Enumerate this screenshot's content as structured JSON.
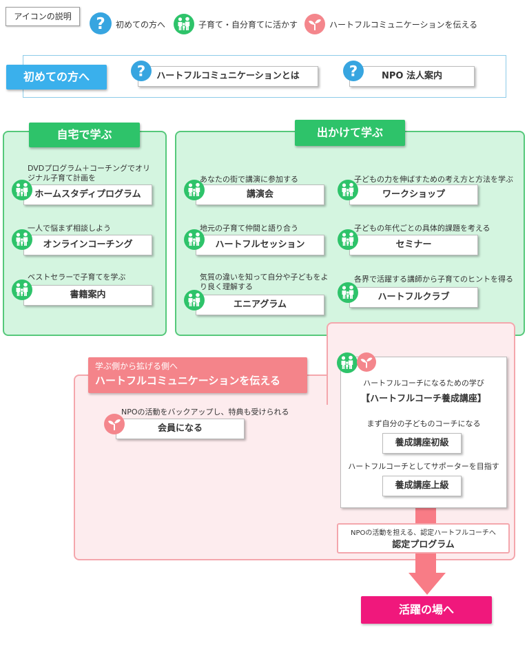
{
  "legend": {
    "label": "アイコンの説明",
    "items": [
      {
        "icon": "question-icon",
        "text": "初めての方へ"
      },
      {
        "icon": "family-icon",
        "text": "子育て・自分育てに活かす"
      },
      {
        "icon": "sprout-icon",
        "text": "ハートフルコミュニケーションを伝える"
      }
    ]
  },
  "intro": {
    "title": "初めての方へ",
    "buttons": [
      "ハートフルコミュニケーションとは",
      "NPO 法人案内"
    ]
  },
  "home": {
    "title": "自宅で学ぶ",
    "items": [
      {
        "desc": "DVDプログラム＋コーチングでオリジナル子育て計画を",
        "label": "ホームスタディプログラム"
      },
      {
        "desc": "一人で悩まず相談しよう",
        "label": "オンラインコーチング"
      },
      {
        "desc": "ベストセラーで子育てを学ぶ",
        "label": "書籍案内"
      }
    ]
  },
  "outside": {
    "title": "出かけて学ぶ",
    "items": [
      {
        "desc": "あなたの街で講演に参加する",
        "label": "講演会"
      },
      {
        "desc": "子どもの力を伸ばすための考え方と方法を学ぶ",
        "label": "ワークショップ"
      },
      {
        "desc": "地元の子育て仲間と語り合う",
        "label": "ハートフルセッション"
      },
      {
        "desc": "子どもの年代ごとの具体的課題を考える",
        "label": "セミナー"
      },
      {
        "desc": "気質の違いを知って自分や子どもをより良く理解する",
        "label": "エニアグラム"
      },
      {
        "desc": "各界で活躍する講師から子育てのヒントを得る",
        "label": "ハートフルクラブ"
      }
    ]
  },
  "share": {
    "subtitle": "学ぶ側から拡げる側へ",
    "title": "ハートフルコミュニケーションを伝える",
    "member_desc": "NPOの活動をバックアップし、特典も受けられる",
    "member_label": "会員になる"
  },
  "coach": {
    "intro": "ハートフルコーチになるための学び",
    "course_title": "【ハートフルコーチ養成講座】",
    "basic_desc": "まず自分の子どものコーチになる",
    "basic_label": "養成講座初級",
    "advanced_desc": "ハートフルコーチとしてサポーターを目指す",
    "advanced_label": "養成講座上級"
  },
  "certified": {
    "desc": "NPOの活動を担える、認定ハートフルコーチへ",
    "label": "認定プログラム"
  },
  "final": {
    "label": "活躍の場へ"
  },
  "colors": {
    "question_blue": "#37a5e0",
    "green": "#2ec36a",
    "green_panel": "#d4f5e0",
    "pink_icon": "#f4868c",
    "pink_panel": "#fdecee",
    "salmon_banner": "#f4848a",
    "arrow": "#f87c86",
    "cta_magenta": "#f0187c"
  }
}
